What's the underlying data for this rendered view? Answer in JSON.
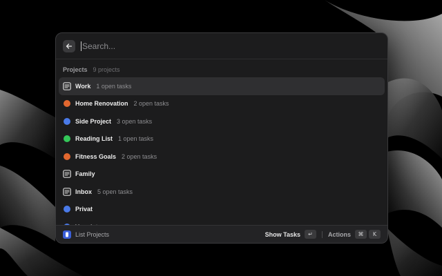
{
  "search": {
    "placeholder": "Search..."
  },
  "section": {
    "title": "Projects",
    "count": "9 projects"
  },
  "items": [
    {
      "title": "Work",
      "subtitle": "1 open tasks",
      "icon": "list-icon",
      "color": "#d8d8d8",
      "selected": true
    },
    {
      "title": "Home Renovation",
      "subtitle": "2 open tasks",
      "icon": "dot",
      "color": "#e2672f"
    },
    {
      "title": "Side Project",
      "subtitle": "3 open tasks",
      "icon": "dot",
      "color": "#4a7ae8"
    },
    {
      "title": "Reading List",
      "subtitle": "1 open tasks",
      "icon": "dot",
      "color": "#34c759"
    },
    {
      "title": "Fitness Goals",
      "subtitle": "2 open tasks",
      "icon": "dot",
      "color": "#e2672f"
    },
    {
      "title": "Family",
      "subtitle": "",
      "icon": "list-icon",
      "color": "#d8d8d8"
    },
    {
      "title": "Inbox",
      "subtitle": "5 open tasks",
      "icon": "list-icon",
      "color": "#d8d8d8"
    },
    {
      "title": "Privat",
      "subtitle": "",
      "icon": "dot",
      "color": "#4a7ae8"
    },
    {
      "title": "Vermietung",
      "subtitle": "",
      "icon": "dot",
      "color": "#4a7ae8"
    }
  ],
  "footer": {
    "app_title": "List Projects",
    "primary_action": "Show Tasks",
    "primary_key": "↵",
    "actions_label": "Actions",
    "action_keys": [
      "⌘",
      "K"
    ]
  }
}
